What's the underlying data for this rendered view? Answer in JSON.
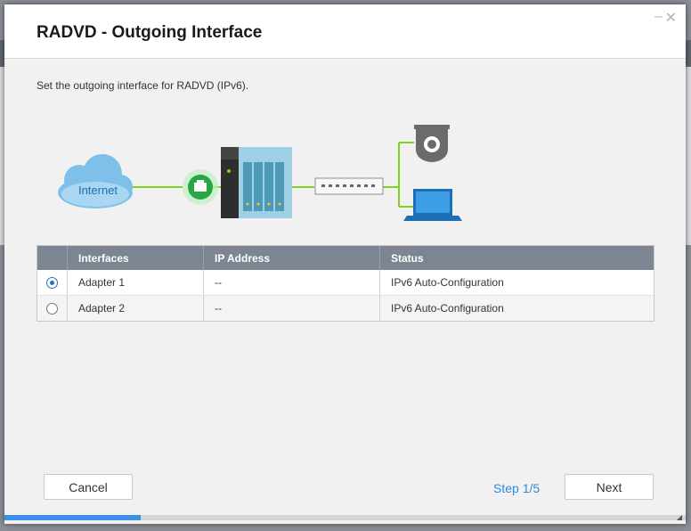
{
  "dialog": {
    "title": "RADVD - Outgoing Interface",
    "description": "Set the outgoing interface for RADVD (IPv6).",
    "controls": {
      "minimize": "–",
      "close": "✕"
    }
  },
  "diagram": {
    "cloud_label": "Internet",
    "icons": [
      "cloud-icon",
      "ethernet-port-icon",
      "nas-icon",
      "switch-icon",
      "camera-icon",
      "laptop-icon"
    ]
  },
  "table": {
    "headers": [
      "",
      "Interfaces",
      "IP Address",
      "Status"
    ],
    "rows": [
      {
        "selected": true,
        "interface": "Adapter 1",
        "ip": "--",
        "status": "IPv6 Auto-Configuration"
      },
      {
        "selected": false,
        "interface": "Adapter 2",
        "ip": "--",
        "status": "IPv6 Auto-Configuration"
      }
    ]
  },
  "footer": {
    "cancel_label": "Cancel",
    "next_label": "Next",
    "step_label": "Step 1/5",
    "progress": 0.2
  },
  "colors": {
    "accent": "#2d8ae0",
    "header_bg": "#7e8592",
    "progress": "#3b8fe6",
    "link_line": "#7ed321"
  }
}
